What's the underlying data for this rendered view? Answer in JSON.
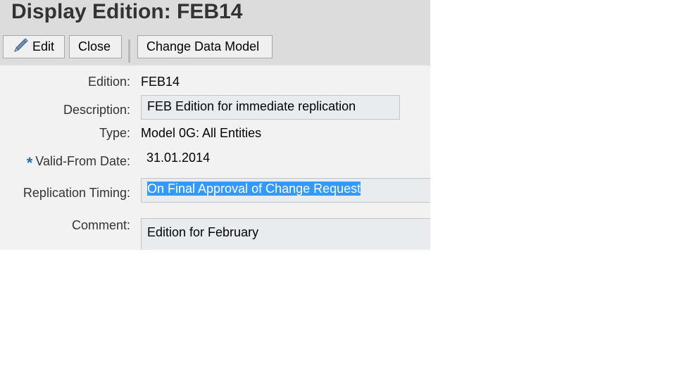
{
  "page": {
    "title": "Display Edition: FEB14"
  },
  "toolbar": {
    "edit_label": "Edit",
    "close_label": "Close",
    "change_data_model_label": "Change Data Model"
  },
  "form": {
    "edition_label": "Edition:",
    "edition_value": "FEB14",
    "description_label": "Description:",
    "description_value": "FEB Edition for immediate replication",
    "type_label": "Type:",
    "type_value": "Model 0G: All Entities",
    "required_marker": "*",
    "valid_from_label": "Valid-From Date:",
    "valid_from_value": "31.01.2014",
    "replication_label": "Replication Timing:",
    "replication_value": "On Final Approval of Change Request",
    "comment_label": "Comment:",
    "comment_value": "Edition for February"
  },
  "colors": {
    "header_bg": "#dcdcdc",
    "panel_bg": "#f2f2f2",
    "field_bg": "#e9ecef",
    "selection": "#3399ff",
    "required_star": "#1c6fb3"
  },
  "icons": {
    "edit": "pencil-icon"
  }
}
